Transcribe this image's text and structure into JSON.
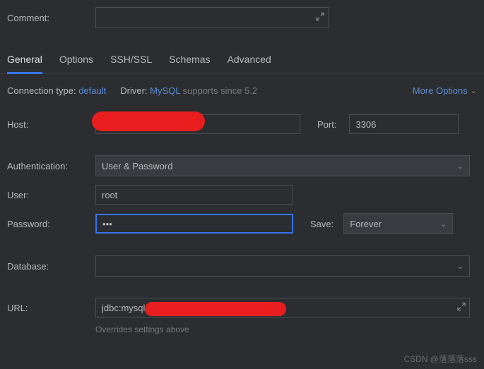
{
  "comment": {
    "label": "Comment:",
    "value": ""
  },
  "tabs": {
    "general": "General",
    "options": "Options",
    "sshssl": "SSH/SSL",
    "schemas": "Schemas",
    "advanced": "Advanced"
  },
  "meta": {
    "conn_type_label": "Connection type:",
    "conn_type_value": "default",
    "driver_label": "Driver:",
    "driver_value": "MySQL",
    "driver_note": "supports since 5.2",
    "more_options": "More Options"
  },
  "form": {
    "host_label": "Host:",
    "host_value": "",
    "port_label": "Port:",
    "port_value": "3306",
    "auth_label": "Authentication:",
    "auth_value": "User & Password",
    "user_label": "User:",
    "user_value": "root",
    "password_label": "Password:",
    "password_value": "•••",
    "save_label": "Save:",
    "save_value": "Forever",
    "database_label": "Database:",
    "database_value": "",
    "url_label": "URL:",
    "url_value": "jdbc:mysql                          04:3306",
    "url_hint": "Overrides settings above"
  },
  "watermark": "CSDN @落落落sss"
}
